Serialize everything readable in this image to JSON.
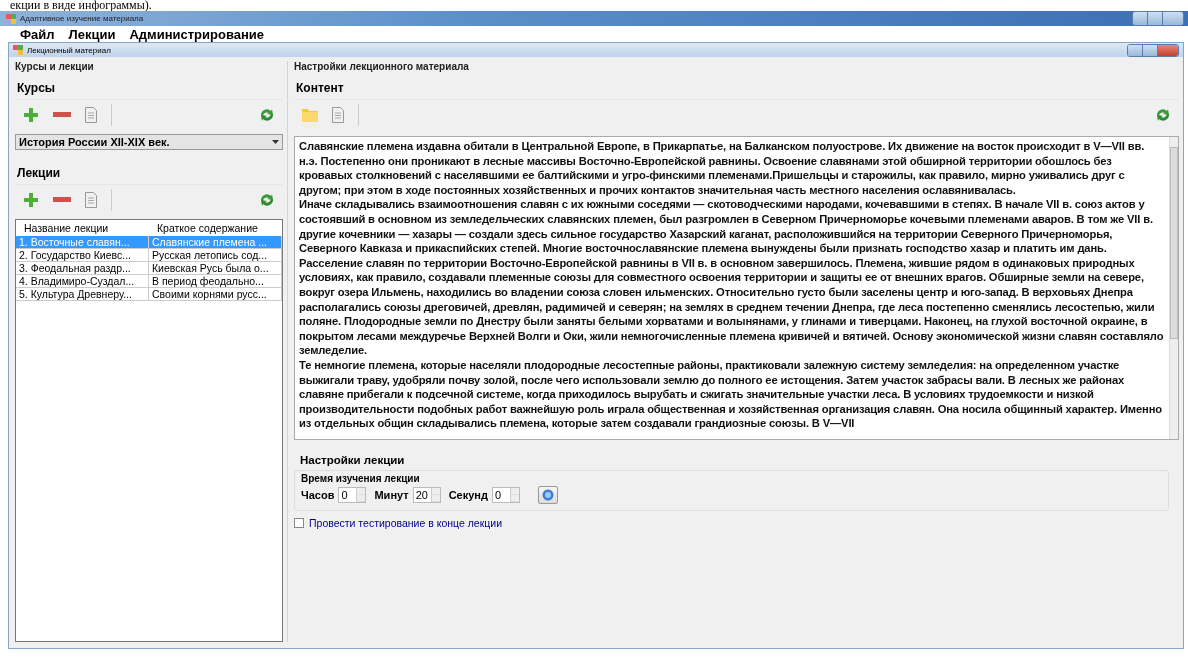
{
  "document_fragment": "екции в виде инфограммы).",
  "window": {
    "title": "Адаптивное изучение материала"
  },
  "menu": [
    "Файл",
    "Лекции",
    "Администрирование"
  ],
  "child_window": {
    "title": "Лекционный материал"
  },
  "left_panel": {
    "title": "Курсы и лекции",
    "courses_heading": "Курсы",
    "course_select": "История России XII-XIX век.",
    "lectures_heading": "Лекции",
    "table": {
      "columns": [
        "Название лекции",
        "Краткое содержание"
      ],
      "rows": [
        {
          "cells": [
            "1. Восточные славян...",
            "Славянские племена ..."
          ],
          "selected": true
        },
        {
          "cells": [
            "2. Государство Киевс...",
            "Русская летопись сод..."
          ],
          "selected": false
        },
        {
          "cells": [
            "3. Феодальная раздр...",
            "Киевская Русь была о..."
          ],
          "selected": false
        },
        {
          "cells": [
            "4. Владимиро-Суздал...",
            "В период феодально..."
          ],
          "selected": false
        },
        {
          "cells": [
            "5. Культура Древнеру...",
            "Своими корнями русс..."
          ],
          "selected": false
        }
      ]
    }
  },
  "right_panel": {
    "title": "Настройки лекционного материала",
    "content_heading": "Контент",
    "paragraphs": [
      "Славянские племена издавна обитали в Центральной Европе, в Прикарпатье, на Балканском полуострове. Их движение на восток происходит в V—VII вв. н.э. Постепенно они проникают в лесные массивы Восточно-Европейской равнины. Освоение славянами этой обширной территории обошлось без кровавых столкновений с населявшими ее балтийскими и угро-финскими племенами.Пришельцы и старожилы, как правило, мирно уживались друг с другом; при этом в ходе постоянных хозяйственных и прочих контактов значительная часть местного населения ославянивалась.",
      "Иначе складывались взаимоотношения славян с их южными соседями — скотоводческими народами, кочевавшими в степях. В начале VII в. союз актов у состоявший в основном из земледельческих славянских племен, был разгромлен в Северном Причерноморье кочевыми племенами аваров. В том же VII в. другие кочевники — хазары — создали здесь сильное государство Хазарский каганат, расположившийся на территории Северного Причерноморья, Северного Кавказа и прикаспийских степей. Многие восточнославянские племена вынуждены были признать господство хазар и платить им дань. Расселение славян по территории Восточно-Европейской равнины в VII в. в основном завершилось. Племена, жившие рядом в одинаковых природных условиях, как правило, создавали племенные союзы для совместного освоения территории и защиты ее от внешних врагов. Обширные земли на севере, вокруг озера Ильмень, находились во владении союза словен ильменских. Относительно густо были заселены центр и юго-запад. В верховьях Днепра располагались союзы дреговичей, древлян, радимичей и северян; на землях в среднем течении Днепра, где леса постепенно сменялись лесостепью, жили поляне. Плодородные земли по Днестру были заняты белыми хорватами и волынянами, у глинами и тиверцами. Наконец, на глухой восточной окраине, в покрытом лесами междуречье Верхней Волги и Оки, жили немногочисленные племена кривичей и вятичей. Основу экономической жизни славян составляло земледелие.",
      "Те немногие племена, которые населяли плодородные лесостепные районы, практиковали залежную систему земледелия: на определенном участке выжигали траву, удобряли почву золой, после чего использовали землю до полного ее истощения. Затем участок забрасы вали. В лесных же районах славяне прибегали к подсечной системе, когда приходилось вырубать и сжигать значительные участки леса. В условиях трудоемкости и низкой производительности подобных работ важнейшую роль играла общественная и хозяйственная организация славян. Она носила общинный характер. Именно из отдельных общин складывались племена, которые затем создавали грандиозные союзы. В V—VII"
    ],
    "settings_heading": "Настройки лекции",
    "time_group": "Время изучения лекции",
    "time_fields": [
      {
        "label": "Часов",
        "value": "0"
      },
      {
        "label": "Минут",
        "value": "20"
      },
      {
        "label": "Секунд",
        "value": "0"
      }
    ],
    "test_checkbox": {
      "label": "Провести тестирование в конце лекции",
      "checked": false
    }
  }
}
